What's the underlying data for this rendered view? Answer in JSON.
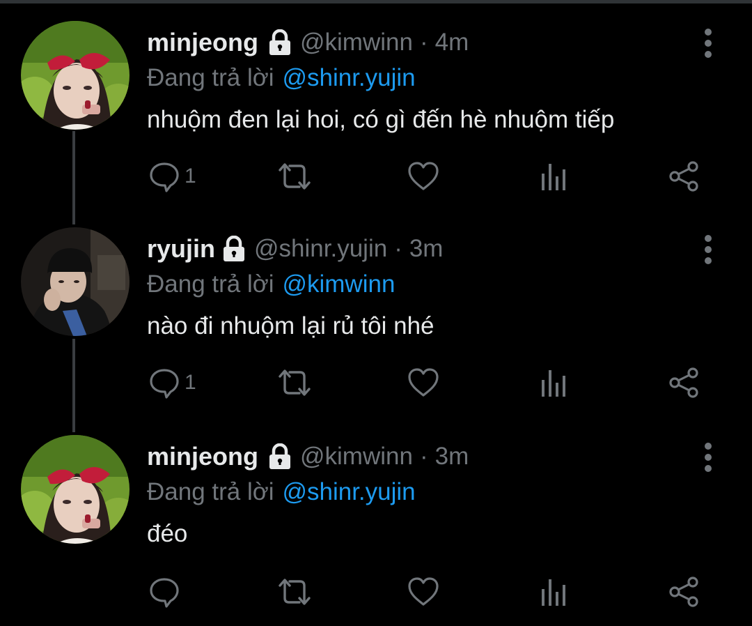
{
  "thread": {
    "tweets": [
      {
        "display_name": "minjeong",
        "handle": "@kimwinn",
        "separator": "·",
        "time": "4m",
        "reply_prefix": "Đang trả lời",
        "reply_to": "@shinr.yujin",
        "text": "nhuộm đen lại hoi, có gì đến hè nhuộm tiếp",
        "reply_count": "1"
      },
      {
        "display_name": "ryujin",
        "handle": "@shinr.yujin",
        "separator": "·",
        "time": "3m",
        "reply_prefix": "Đang trả lời",
        "reply_to": "@kimwinn",
        "text": "nào đi nhuộm lại rủ tôi nhé",
        "reply_count": "1"
      },
      {
        "display_name": "minjeong",
        "handle": "@kimwinn",
        "separator": "·",
        "time": "3m",
        "reply_prefix": "Đang trả lời",
        "reply_to": "@shinr.yujin",
        "text": "đéo",
        "reply_count": ""
      }
    ]
  },
  "icons": {
    "protected": "lock-icon",
    "more": "more-vertical-icon",
    "reply": "reply-icon",
    "retweet": "retweet-icon",
    "like": "heart-icon",
    "views": "views-icon",
    "share": "share-icon"
  },
  "colors": {
    "background": "#000000",
    "text_primary": "#e7e9ea",
    "text_secondary": "#71767b",
    "link": "#1d9bf0",
    "thread_line": "#3a3d41"
  }
}
